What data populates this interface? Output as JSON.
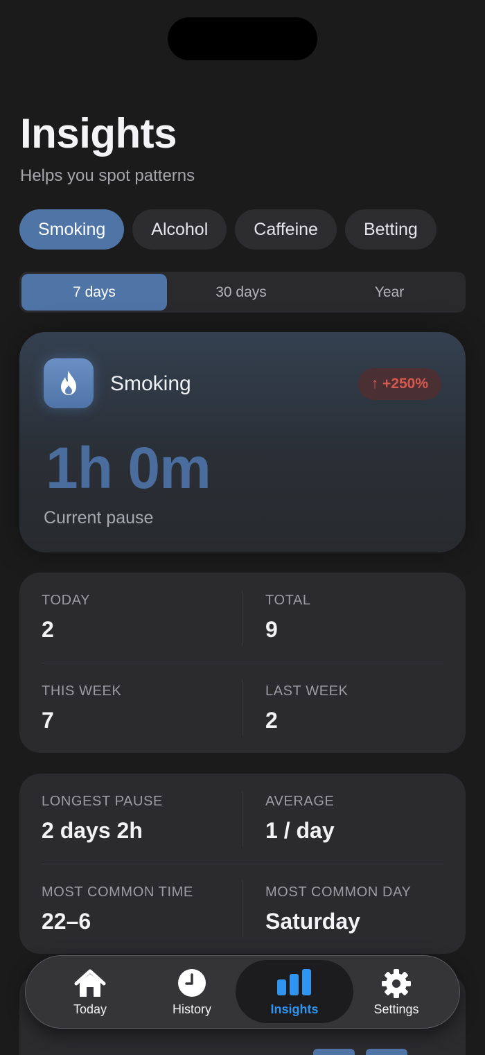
{
  "header": {
    "title": "Insights",
    "subtitle": "Helps you spot patterns"
  },
  "categories": [
    {
      "label": "Smoking",
      "active": true
    },
    {
      "label": "Alcohol",
      "active": false
    },
    {
      "label": "Caffeine",
      "active": false
    },
    {
      "label": "Betting",
      "active": false
    }
  ],
  "periods": [
    {
      "label": "7 days",
      "active": true
    },
    {
      "label": "30 days",
      "active": false
    },
    {
      "label": "Year",
      "active": false
    }
  ],
  "hero": {
    "icon": "flame-icon",
    "name": "Smoking",
    "trend_arrow": "↑",
    "trend": "+250%",
    "value": "1h 0m",
    "caption": "Current pause"
  },
  "counts": {
    "today_label": "TODAY",
    "today_value": "2",
    "total_label": "TOTAL",
    "total_value": "9",
    "this_week_label": "THIS WEEK",
    "this_week_value": "7",
    "last_week_label": "LAST WEEK",
    "last_week_value": "2"
  },
  "patterns": {
    "longest_label": "LONGEST PAUSE",
    "longest_value": "2 days 2h",
    "average_label": "AVERAGE",
    "average_value": "1 / day",
    "common_time_label": "MOST COMMON TIME",
    "common_time_value": "22–6",
    "common_day_label": "MOST COMMON DAY",
    "common_day_value": "Saturday"
  },
  "tabbar": {
    "today": "Today",
    "history": "History",
    "insights": "Insights",
    "settings": "Settings"
  },
  "colors": {
    "accent": "#4f74a6",
    "active_tab": "#2f95f0",
    "trend_up": "#d9584f"
  }
}
